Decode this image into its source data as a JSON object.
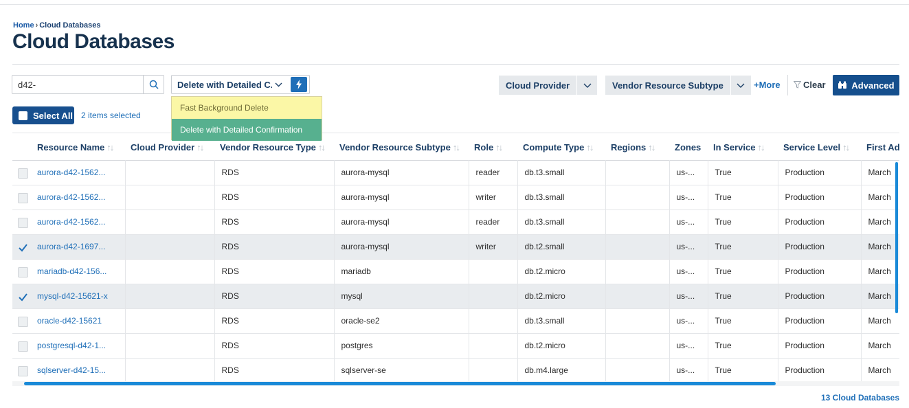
{
  "breadcrumb": {
    "home": "Home",
    "separator": "›",
    "current": "Cloud Databases"
  },
  "page_title": "Cloud Databases",
  "search": {
    "value": "d42-",
    "icon": "search-icon"
  },
  "delete_action": {
    "selected_label": "Delete with Detailed C...",
    "options": [
      "Fast Background Delete",
      "Delete with Detailed Confirmation"
    ],
    "highlighted_option": "Delete with Detailed Confirmation",
    "run_icon": "bolt-icon"
  },
  "filters": {
    "cloud_provider": "Cloud Provider",
    "vendor_resource_subtype": "Vendor Resource Subtype",
    "more": "+More",
    "clear": "Clear",
    "advanced": "Advanced"
  },
  "selection": {
    "select_all": "Select All",
    "items_selected": "2 items selected"
  },
  "table": {
    "columns": [
      "Resource Name",
      "Cloud Provider",
      "Vendor Resource Type",
      "Vendor Resource Subtype",
      "Role",
      "Compute Type",
      "Regions",
      "Zones",
      "In Service",
      "Service Level",
      "First Added"
    ],
    "rows": [
      {
        "name": "aurora-d42-1562...",
        "provider": "",
        "type": "RDS",
        "subtype": "aurora-mysql",
        "role": "reader",
        "compute": "db.t3.small",
        "regions": "",
        "zones": "us-...",
        "in_service": "True",
        "level": "Production",
        "first_added": "March",
        "checked": false
      },
      {
        "name": "aurora-d42-1562...",
        "provider": "",
        "type": "RDS",
        "subtype": "aurora-mysql",
        "role": "writer",
        "compute": "db.t3.small",
        "regions": "",
        "zones": "us-...",
        "in_service": "True",
        "level": "Production",
        "first_added": "March",
        "checked": false
      },
      {
        "name": "aurora-d42-1562...",
        "provider": "",
        "type": "RDS",
        "subtype": "aurora-mysql",
        "role": "reader",
        "compute": "db.t3.small",
        "regions": "",
        "zones": "us-...",
        "in_service": "True",
        "level": "Production",
        "first_added": "March",
        "checked": false
      },
      {
        "name": "aurora-d42-1697...",
        "provider": "",
        "type": "RDS",
        "subtype": "aurora-mysql",
        "role": "writer",
        "compute": "db.t2.small",
        "regions": "",
        "zones": "us-...",
        "in_service": "True",
        "level": "Production",
        "first_added": "March",
        "checked": true
      },
      {
        "name": "mariadb-d42-156...",
        "provider": "",
        "type": "RDS",
        "subtype": "mariadb",
        "role": "",
        "compute": "db.t2.micro",
        "regions": "",
        "zones": "us-...",
        "in_service": "True",
        "level": "Production",
        "first_added": "March",
        "checked": false
      },
      {
        "name": "mysql-d42-15621-x",
        "provider": "",
        "type": "RDS",
        "subtype": "mysql",
        "role": "",
        "compute": "db.t2.micro",
        "regions": "",
        "zones": "us-...",
        "in_service": "True",
        "level": "Production",
        "first_added": "March",
        "checked": true
      },
      {
        "name": "oracle-d42-15621",
        "provider": "",
        "type": "RDS",
        "subtype": "oracle-se2",
        "role": "",
        "compute": "db.t3.small",
        "regions": "",
        "zones": "us-...",
        "in_service": "True",
        "level": "Production",
        "first_added": "March",
        "checked": false
      },
      {
        "name": "postgresql-d42-1...",
        "provider": "",
        "type": "RDS",
        "subtype": "postgres",
        "role": "",
        "compute": "db.t2.micro",
        "regions": "",
        "zones": "us-...",
        "in_service": "True",
        "level": "Production",
        "first_added": "March",
        "checked": false
      },
      {
        "name": "sqlserver-d42-15...",
        "provider": "",
        "type": "RDS",
        "subtype": "sqlserver-se",
        "role": "",
        "compute": "db.m4.large",
        "regions": "",
        "zones": "us-...",
        "in_service": "True",
        "level": "Production",
        "first_added": "March",
        "checked": false
      }
    ]
  },
  "footer": {
    "count": "13 Cloud Databases"
  },
  "colors": {
    "primary": "#154f8d",
    "link": "#1f6fb8",
    "dropdown_option": "#fbf7a6",
    "dropdown_highlight": "#57b08f",
    "scrollbar": "#1a8ad8"
  }
}
